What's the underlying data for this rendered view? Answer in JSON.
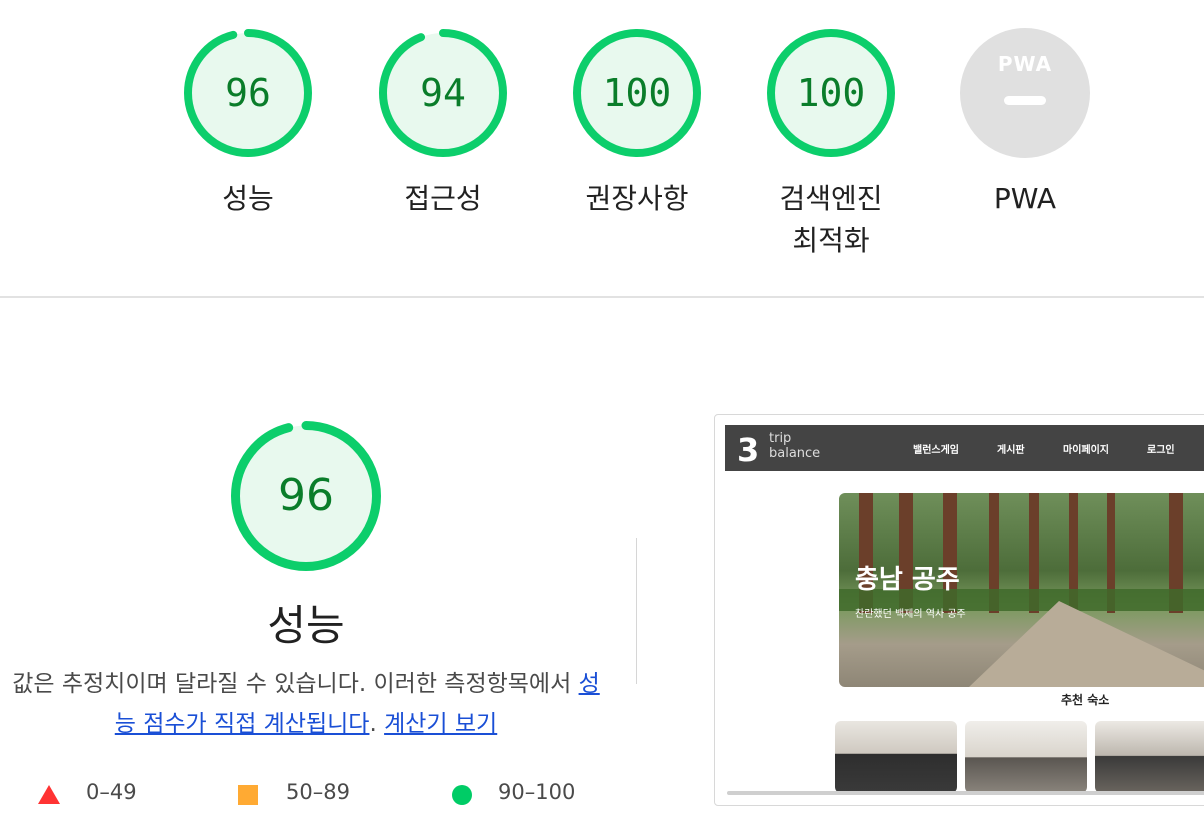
{
  "gauges": [
    {
      "score": "96",
      "label": "성능",
      "value": 96
    },
    {
      "score": "94",
      "label": "접근성",
      "value": 94
    },
    {
      "score": "100",
      "label": "권장사항",
      "value": 100
    },
    {
      "score": "100",
      "label": "검색엔진\n최적화",
      "label_line1": "검색엔진",
      "label_line2": "최적화",
      "value": 100
    },
    {
      "score": "—",
      "label": "PWA",
      "logo": "PWA"
    }
  ],
  "performance": {
    "score": "96",
    "value": 96,
    "title": "성능",
    "desc_prefix": "값은 추정치이며 달라질 수 있습니다. 이러한 측정항목에서 ",
    "link1": "성능 점수가 직접 계산됩니다",
    "desc_mid": ". ",
    "link2": "계산기 보기"
  },
  "legend": {
    "fail": "0–49",
    "average": "50–89",
    "pass": "90–100"
  },
  "colors": {
    "pass": "#0cce6b",
    "pass_text": "#0a7d2a",
    "average": "#ffa400",
    "fail": "#ff3333",
    "pass_bg": "#e8f9ee"
  },
  "screenshot": {
    "logo_mark": "3",
    "logo_line1": "trip",
    "logo_line2": "balance",
    "nav": [
      "밸런스게임",
      "게시판",
      "마이페이지",
      "로그인"
    ],
    "hero_title": "충남 공주",
    "hero_subtitle": "찬란했던 백제의 역사 공주",
    "section_title": "추천 숙소"
  }
}
